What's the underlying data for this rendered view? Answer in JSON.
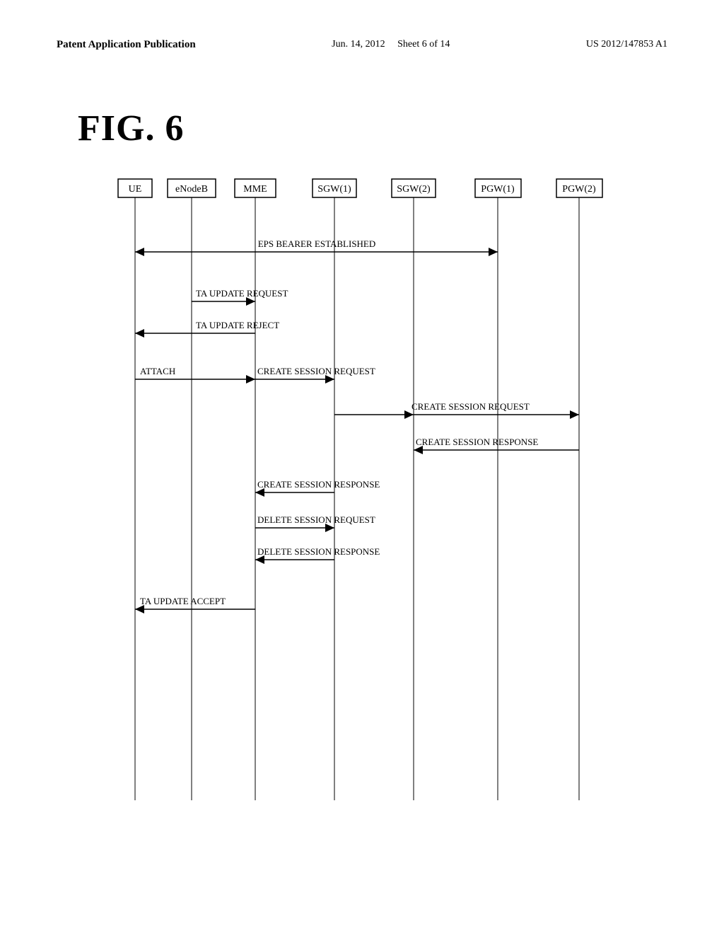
{
  "header": {
    "left": "Patent Application Publication",
    "center_line1": "Jun. 14, 2012",
    "center_line2": "Sheet 6 of 14",
    "right": "US 2012/147853 A1"
  },
  "figure": {
    "title": "FIG. 6"
  },
  "nodes": [
    "UE",
    "eNodeB",
    "MME",
    "SGW(1)",
    "SGW(2)",
    "PGW(1)",
    "PGW(2)"
  ],
  "messages": [
    {
      "label": "EPS BEARER ESTABLISHED",
      "type": "bidirectional"
    },
    {
      "label": "TA UPDATE REQUEST",
      "type": "right"
    },
    {
      "label": "TA UPDATE REJECT",
      "type": "left"
    },
    {
      "label": "ATTACH",
      "type": "right"
    },
    {
      "label": "CREATE SESSION REQUEST",
      "type": "right"
    },
    {
      "label": "CREATE SESSION REQUEST",
      "type": "right"
    },
    {
      "label": "CREATE SESSION RESPONSE",
      "type": "left"
    },
    {
      "label": "CREATE SESSION RESPONSE",
      "type": "left"
    },
    {
      "label": "DELETE SESSION REQUEST",
      "type": "right"
    },
    {
      "label": "DELETE SESSION RESPONSE",
      "type": "left"
    },
    {
      "label": "TA UPDATE ACCEPT",
      "type": "left"
    }
  ]
}
